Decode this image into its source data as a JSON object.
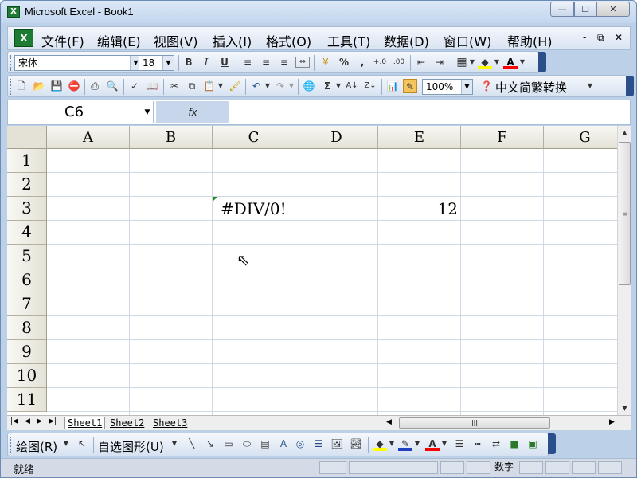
{
  "window": {
    "title": "Microsoft Excel - Book1",
    "app_icon": "excel-icon"
  },
  "titlebar_buttons": {
    "minimize": "—",
    "maximize": "☐",
    "close": "✕"
  },
  "menubar": {
    "items": [
      "文件(F)",
      "编辑(E)",
      "视图(V)",
      "插入(I)",
      "格式(O)",
      "工具(T)",
      "数据(D)",
      "窗口(W)",
      "帮助(H)"
    ],
    "mdi": {
      "minimize": "-",
      "restore": "⧉",
      "close": "✕"
    }
  },
  "format_toolbar": {
    "font_name": "宋体",
    "font_size": "18",
    "bold": "B",
    "italic": "I",
    "underline": "U",
    "percent": "%",
    "comma": ",",
    "fill_color": "#ffff00",
    "font_color": "#ff0000"
  },
  "standard_toolbar": {
    "zoom": "100%",
    "chinese_convert": "中文简繁转换",
    "sum": "Σ"
  },
  "formula_bar": {
    "name_box": "C6",
    "fx": "fx",
    "content": ""
  },
  "grid": {
    "columns": [
      "A",
      "B",
      "C",
      "D",
      "E",
      "F",
      "G"
    ],
    "rows": [
      "1",
      "2",
      "3",
      "4",
      "5",
      "6",
      "7",
      "8",
      "9",
      "10",
      "11"
    ],
    "cells": {
      "C3": "#DIV/0!",
      "E3": "12"
    }
  },
  "sheets": {
    "tabs": [
      "Sheet1",
      "Sheet2",
      "Sheet3"
    ],
    "active": "Sheet1"
  },
  "drawing_toolbar": {
    "draw_menu": "绘图(R)",
    "autoshapes_menu": "自选图形(U)"
  },
  "statusbar": {
    "ready": "就绪",
    "mode": "数字"
  }
}
